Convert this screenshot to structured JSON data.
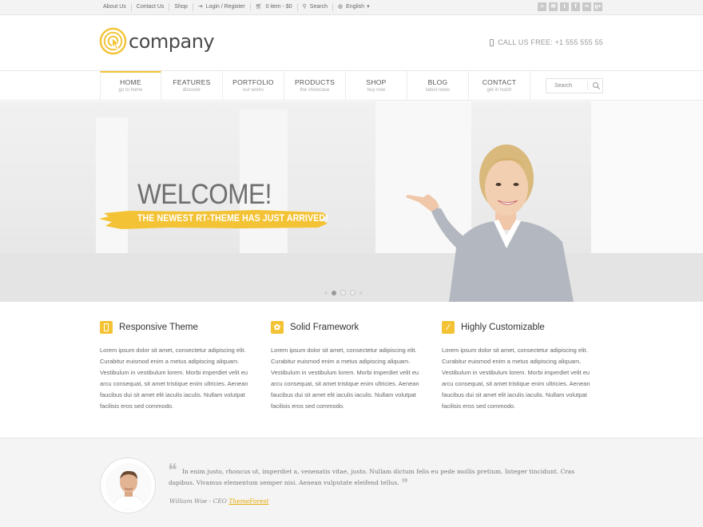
{
  "topbar": {
    "links": [
      {
        "label": "About Us",
        "icon": ""
      },
      {
        "label": "Contact Us",
        "icon": ""
      },
      {
        "label": "Shop",
        "icon": ""
      },
      {
        "label": "Login / Register",
        "icon": "login-icon"
      },
      {
        "label": "0 item - $0",
        "icon": "cart-icon"
      },
      {
        "label": "Search",
        "icon": "search-icon"
      },
      {
        "label": "English",
        "icon": "globe-icon"
      }
    ],
    "social": [
      "rss-icon",
      "mail-icon",
      "twitter-icon",
      "facebook-icon",
      "flickr-icon",
      "google-plus-icon"
    ]
  },
  "header": {
    "logo_text": "company",
    "call_us": "CALL US FREE: +1 555 555 55"
  },
  "nav": {
    "items": [
      {
        "label": "HOME",
        "sub": "go to home"
      },
      {
        "label": "FEATURES",
        "sub": "discover"
      },
      {
        "label": "PORTFOLIO",
        "sub": "our works"
      },
      {
        "label": "PRODUCTS",
        "sub": "the showcase"
      },
      {
        "label": "SHOP",
        "sub": "buy now"
      },
      {
        "label": "BLOG",
        "sub": "latest news"
      },
      {
        "label": "CONTACT",
        "sub": "get in touch"
      }
    ],
    "active": "HOME",
    "search_placeholder": "Search"
  },
  "hero": {
    "title": "WELCOME!",
    "tagline": "THE NEWEST RT-THEME HAS JUST ARRIVED!",
    "slides": 3,
    "active_slide": 1
  },
  "features": [
    {
      "title": "Responsive Theme",
      "icon": "mobile-icon",
      "body": "Lorem ipsum dolor sit amet, consectetur adipiscing elit. Curabitur euismod enim a metus adipiscing aliquam. Vestibulum in vestibulum lorem. Morbi imperdiet velit eu arcu consequat, sit amet tristique enim ultricies. Aenean faucibus dui sit amet elit iaculis iaculis. Nullam volutpat facilisis eros sed commodo."
    },
    {
      "title": "Solid Framework",
      "icon": "gear-icon",
      "body": "Lorem ipsum dolor sit amet, consectetur adipiscing elit. Curabitur euismod enim a metus adipiscing aliquam. Vestibulum in vestibulum lorem. Morbi imperdiet velit eu arcu consequat, sit amet tristique enim ultricies. Aenean faucibus dui sit amet elit iaculis iaculis. Nullam volutpat facilisis eros sed commodo."
    },
    {
      "title": "Highly Customizable",
      "icon": "magic-wand-icon",
      "body": "Lorem ipsum dolor sit amet, consectetur adipiscing elit. Curabitur euismod enim a metus adipiscing aliquam. Vestibulum in vestibulum lorem. Morbi imperdiet velit eu arcu consequat, sit amet tristique enim ultricies. Aenean faucibus dui sit amet elit iaculis iaculis. Nullam volutpat facilisis eros sed commodo."
    }
  ],
  "testimonial": {
    "quote": "In enim justo, rhoncus ut, imperdiet a, venenatis vitae, justo. Nullam dictum felis eu pede mollis pretium. Integer tincidunt. Cras dapibus. Vivamus elementum semper nisi. Aenean vulputate eleifend tellus.",
    "author": "William Woe - CEO",
    "company": "ThemeForest"
  },
  "colors": {
    "accent": "#f3c335",
    "text": "#555555",
    "topbar_bg": "#f3f3f3",
    "testimonial_bg": "#f4f4f4"
  }
}
